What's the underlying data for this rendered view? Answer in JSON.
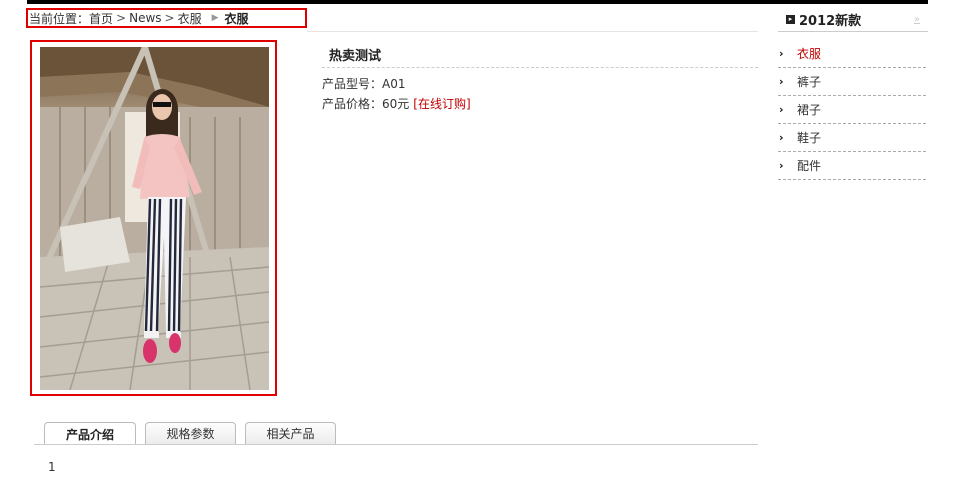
{
  "breadcrumb": {
    "prefix": "当前位置：",
    "home": "首页",
    "sep1": ">",
    "news": "News",
    "sep2": ">",
    "category": "衣服",
    "current": "衣服"
  },
  "product": {
    "title": "热卖测试",
    "model_label": "产品型号：",
    "model_value": "A01",
    "price_label": "产品价格：",
    "price_value": "60元",
    "order_link": "[在线订购]"
  },
  "sidebar": {
    "title": "2012新款",
    "more": "»",
    "items": [
      {
        "label": "衣服",
        "active": true
      },
      {
        "label": "裤子",
        "active": false
      },
      {
        "label": "裙子",
        "active": false
      },
      {
        "label": "鞋子",
        "active": false
      },
      {
        "label": "配件",
        "active": false
      }
    ]
  },
  "tabs": [
    {
      "label": "产品介绍",
      "active": true
    },
    {
      "label": "规格参数",
      "active": false
    },
    {
      "label": "相关产品",
      "active": false
    }
  ],
  "tab_content": "1",
  "colors": {
    "highlight_border": "#e00000",
    "link_red": "#c00000",
    "top_bar": "#000000"
  }
}
